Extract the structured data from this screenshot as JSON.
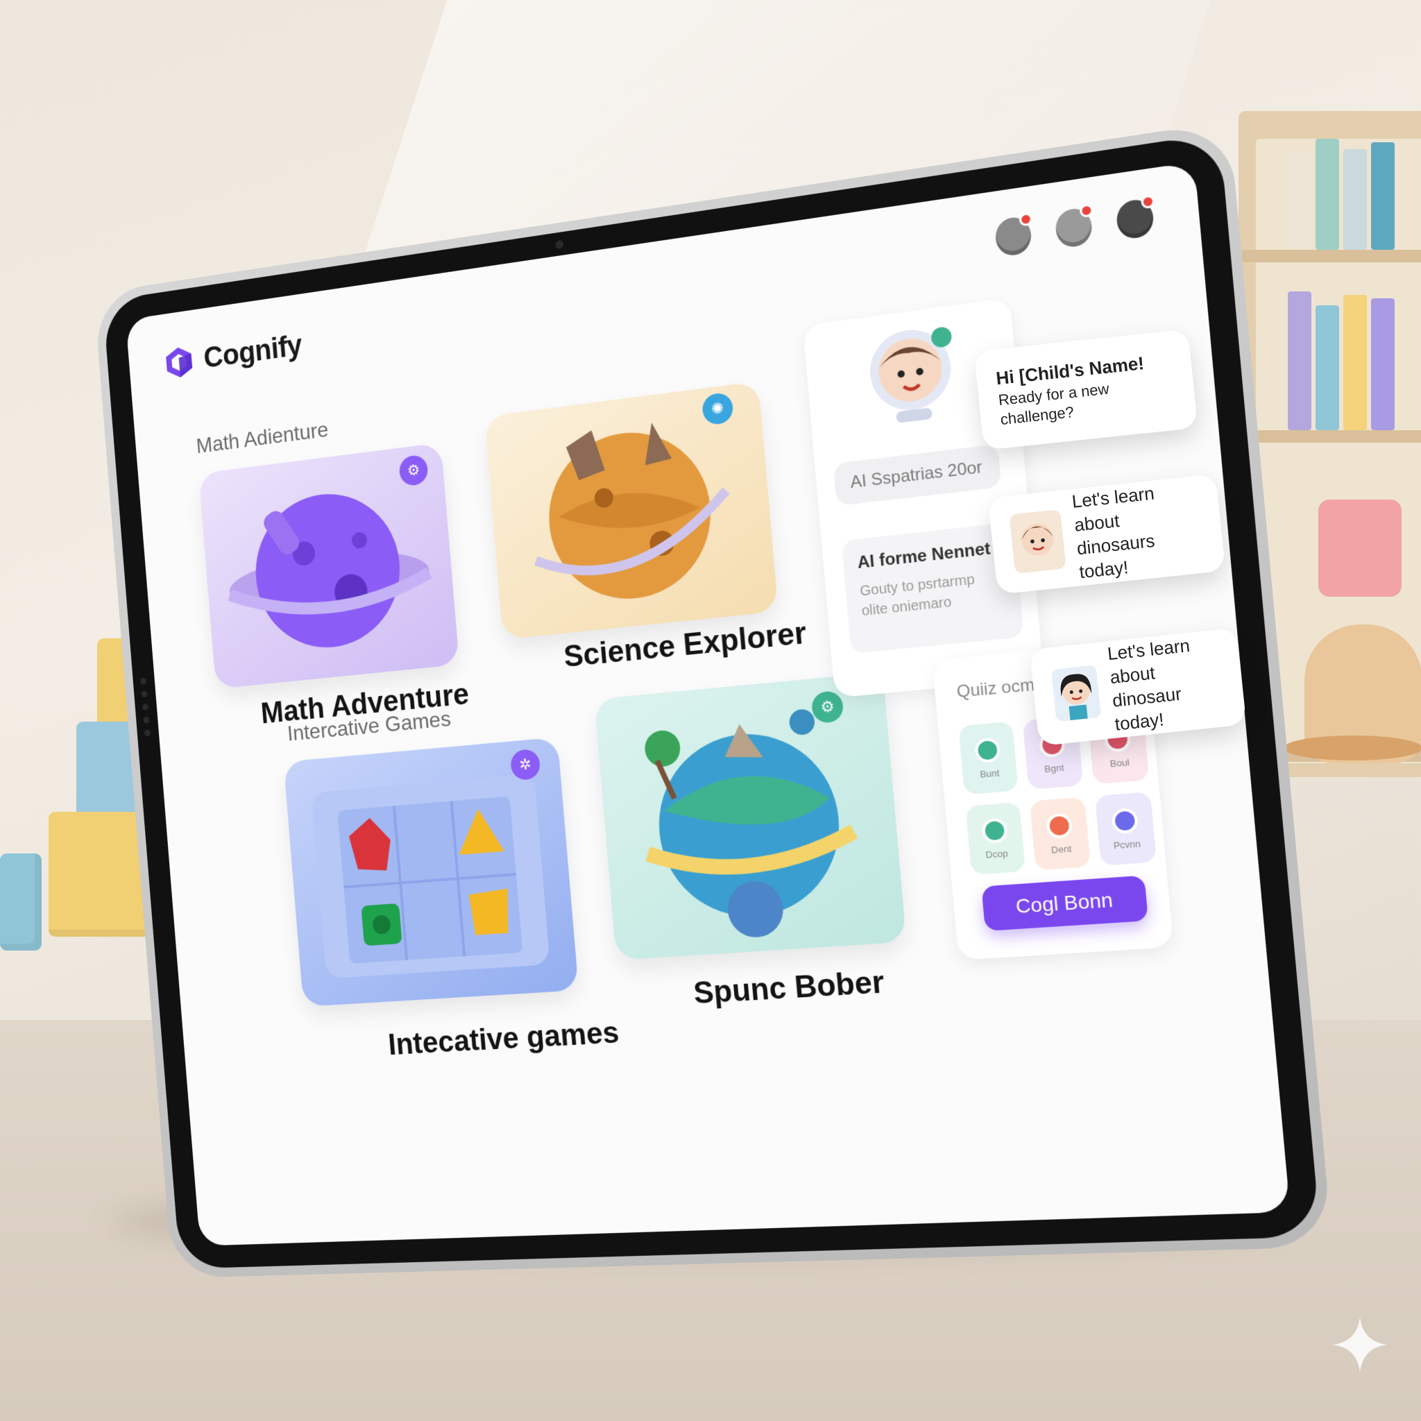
{
  "app": {
    "name": "Cognify"
  },
  "sections": {
    "top": "Math Adienture",
    "bottom": "Intercative Games"
  },
  "tiles": [
    {
      "id": "math",
      "title": "Math Adventure",
      "accent": "#8b5cf6"
    },
    {
      "id": "science",
      "title": "Science Explorer",
      "accent": "#f4a340"
    },
    {
      "id": "games",
      "title": "Intecative games",
      "accent": "#6d8ff0"
    },
    {
      "id": "spunc",
      "title": "Spunc Bober",
      "accent": "#3fb38f"
    }
  ],
  "assistant": {
    "chip1": "AI Sspatrias 20or",
    "card2_title": "AI forme Nennet",
    "card2_body": "Gouty to psrtarmp olite oniemaro"
  },
  "bubbles": [
    {
      "text1": "Hi [Child's Name!",
      "text2": "Ready for a new challenge?"
    },
    {
      "text1": "Let's learn about",
      "text2": "dinosaurs today!"
    },
    {
      "text1": "Let's learn about",
      "text2": "dinosaur today!"
    }
  ],
  "quiz": {
    "title": "Quiiz ocmes",
    "cells": [
      {
        "label": "Bunt",
        "bg": "#dff3ef",
        "icon": "#3fb38f"
      },
      {
        "label": "Bgnt",
        "bg": "#efe6fb",
        "icon": "#e0566a"
      },
      {
        "label": "Boul",
        "bg": "#fbe6ee",
        "icon": "#e0566a"
      },
      {
        "label": "Dcop",
        "bg": "#e2f5ec",
        "icon": "#3fb38f"
      },
      {
        "label": "Dent",
        "bg": "#fde9df",
        "icon": "#ee6b4d"
      },
      {
        "label": "Pcvnn",
        "bg": "#ebe8fb",
        "icon": "#6b6ae8"
      }
    ],
    "button": "Cogl Bonn"
  },
  "colors": {
    "brand": "#7a47ef"
  }
}
